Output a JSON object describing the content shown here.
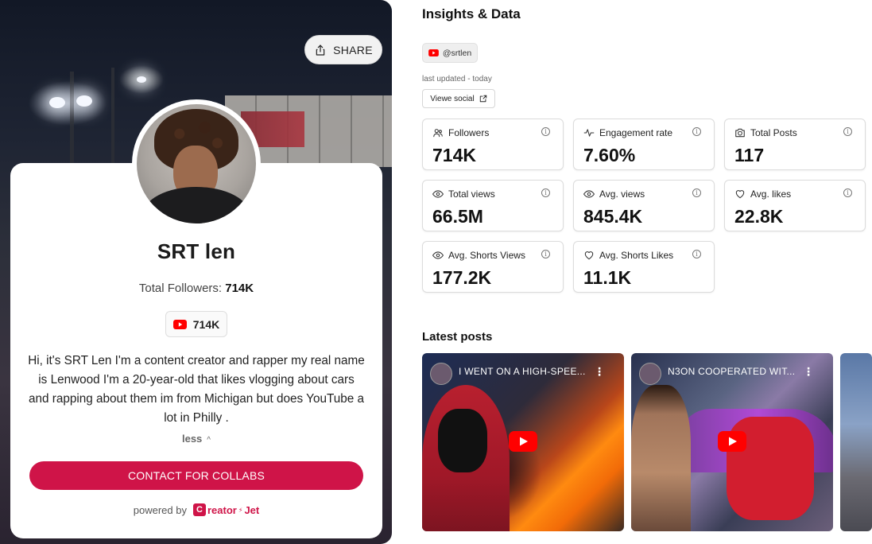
{
  "profile": {
    "share_label": "SHARE",
    "name": "SRT len",
    "total_followers_label": "Total Followers:",
    "total_followers_value": "714K",
    "youtube_count": "714K",
    "bio": "Hi, it's SRT Len I'm a content creator and rapper my real name is Lenwood I'm a 20-year-old that likes vlogging about cars and rapping about them im from Michigan but does YouTube a lot in Philly .",
    "less_label": "less",
    "collab_button": "CONTACT FOR COLLABS",
    "powered_by": "powered by",
    "brand": "reator",
    "brand_suffix": "Jet",
    "brand_letter": "C"
  },
  "insights": {
    "title": "Insights & Data",
    "handle": "@srtlen",
    "last_updated": "last updated - today",
    "view_social": "Viewe social"
  },
  "stats": [
    {
      "label": "Followers",
      "value": "714K",
      "icon": "users-icon"
    },
    {
      "label": "Engagement rate",
      "value": "7.60%",
      "icon": "activity-icon"
    },
    {
      "label": "Total Posts",
      "value": "117",
      "icon": "camera-icon"
    },
    {
      "label": "Total views",
      "value": "66.5M",
      "icon": "eye-icon"
    },
    {
      "label": "Avg. views",
      "value": "845.4K",
      "icon": "eye-icon"
    },
    {
      "label": "Avg. likes",
      "value": "22.8K",
      "icon": "heart-icon"
    },
    {
      "label": "Avg. Shorts Views",
      "value": "177.2K",
      "icon": "eye-icon"
    },
    {
      "label": "Avg. Shorts Likes",
      "value": "11.1K",
      "icon": "heart-icon"
    }
  ],
  "latest_posts": {
    "title": "Latest posts",
    "posts": [
      {
        "title": "I WENT ON A HIGH-SPEE..."
      },
      {
        "title": "N3ON COOPERATED WIT..."
      }
    ]
  },
  "colors": {
    "accent": "#cf1448",
    "youtube_red": "#ff0000"
  }
}
